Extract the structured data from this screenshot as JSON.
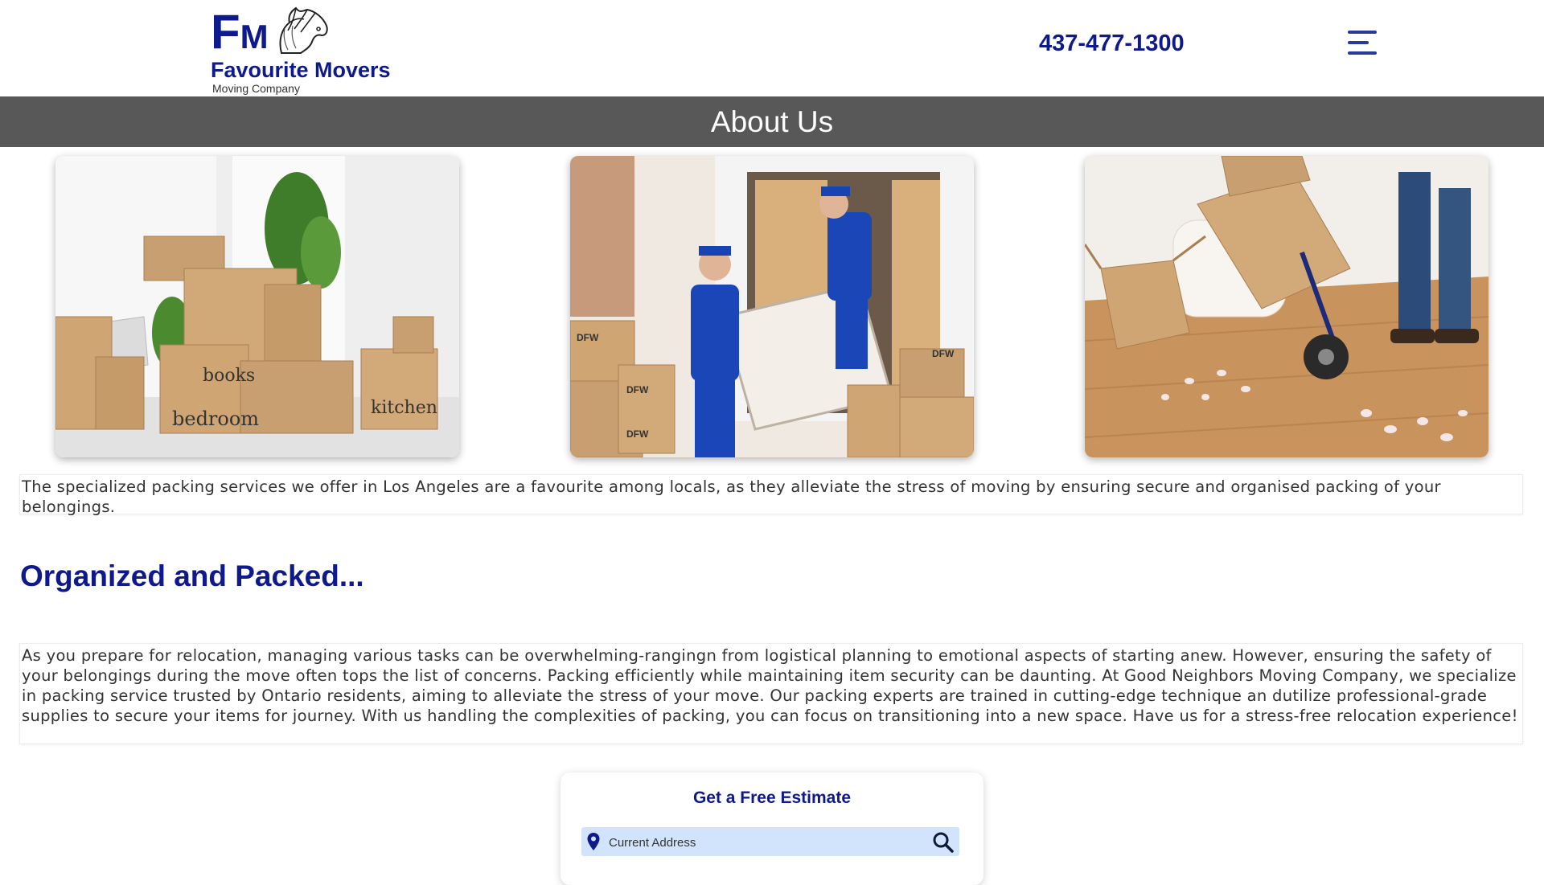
{
  "header": {
    "logo": {
      "letter_f": "F",
      "letter_m": "M",
      "name": "Favourite Movers",
      "subtitle": "Moving Company"
    },
    "phone": "437-477-1300",
    "menu_icon": "hamburger-menu-icon"
  },
  "banner": {
    "title": "About Us"
  },
  "photos": [
    {
      "name": "packed-boxes-room-photo",
      "box_labels": [
        "books",
        "bedroom",
        "kitchen"
      ]
    },
    {
      "name": "movers-loading-van-photo",
      "box_labels": [
        "DFW",
        "DFW",
        "DFW",
        "DFW"
      ]
    },
    {
      "name": "hand-truck-boxes-photo"
    }
  ],
  "intro_text": "The specialized packing services we offer in Los Angeles are a favourite among locals, as they alleviate the stress of moving by ensuring secure and organised packing of your belongings.",
  "section": {
    "title": "Organized and Packed...",
    "body": "As you prepare for relocation, managing various tasks can be overwhelming-rangingn from logistical planning to emotional aspects of starting anew. However, ensuring the safety of your belongings during the move often tops the list of concerns. Packing efficiently while maintaining item security can be daunting. At Good Neighbors Moving Company, we specialize in packing service trusted by Ontario residents, aiming to alleviate the stress of your move. Our packing experts are trained in cutting-edge technique an dutilize professional-grade supplies to secure your items for journey. With us handling the complexities of packing, you can focus on transitioning into a new space. Have us for a stress-free relocation experience!"
  },
  "estimate": {
    "title": "Get a Free Estimate",
    "address_placeholder": "Current Address",
    "pin_icon": "location-pin-icon",
    "search_icon": "search-icon"
  },
  "colors": {
    "brand": "#0e1a8c",
    "banner": "#585858",
    "input_bg": "#d2e4fb"
  }
}
